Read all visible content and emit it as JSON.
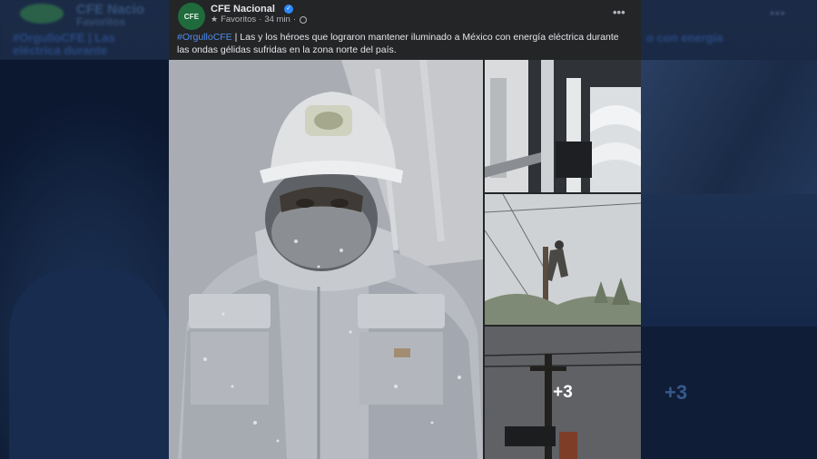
{
  "post": {
    "page_name": "CFE Nacional",
    "avatar_text": "CFE",
    "audience": "Favoritos",
    "time": "34 min",
    "separator": "·",
    "hashtag": "#OrgulloCFE",
    "body": " | Las y los héroes que lograron mantener iluminado a México con energía eléctrica durante las ondas gélidas sufridas en la zona norte del país.",
    "more_menu": "•••",
    "extra_photos": "+3"
  },
  "background": {
    "name": "CFE Nacio",
    "sub": "Favoritos",
    "line1": "#OrgulloCFE | Las",
    "line2": "eléctrica durante",
    "line1_right": "o con energía",
    "plus": "+3"
  },
  "icons": {
    "verified": "verified-badge-icon",
    "audience": "star-icon",
    "privacy": "globe-icon",
    "menu": "more-options-icon"
  },
  "colors": {
    "card": "#242526",
    "hashtag": "#4e8cf0",
    "verified": "#2d88ff",
    "brand": "#1f6b3c"
  }
}
